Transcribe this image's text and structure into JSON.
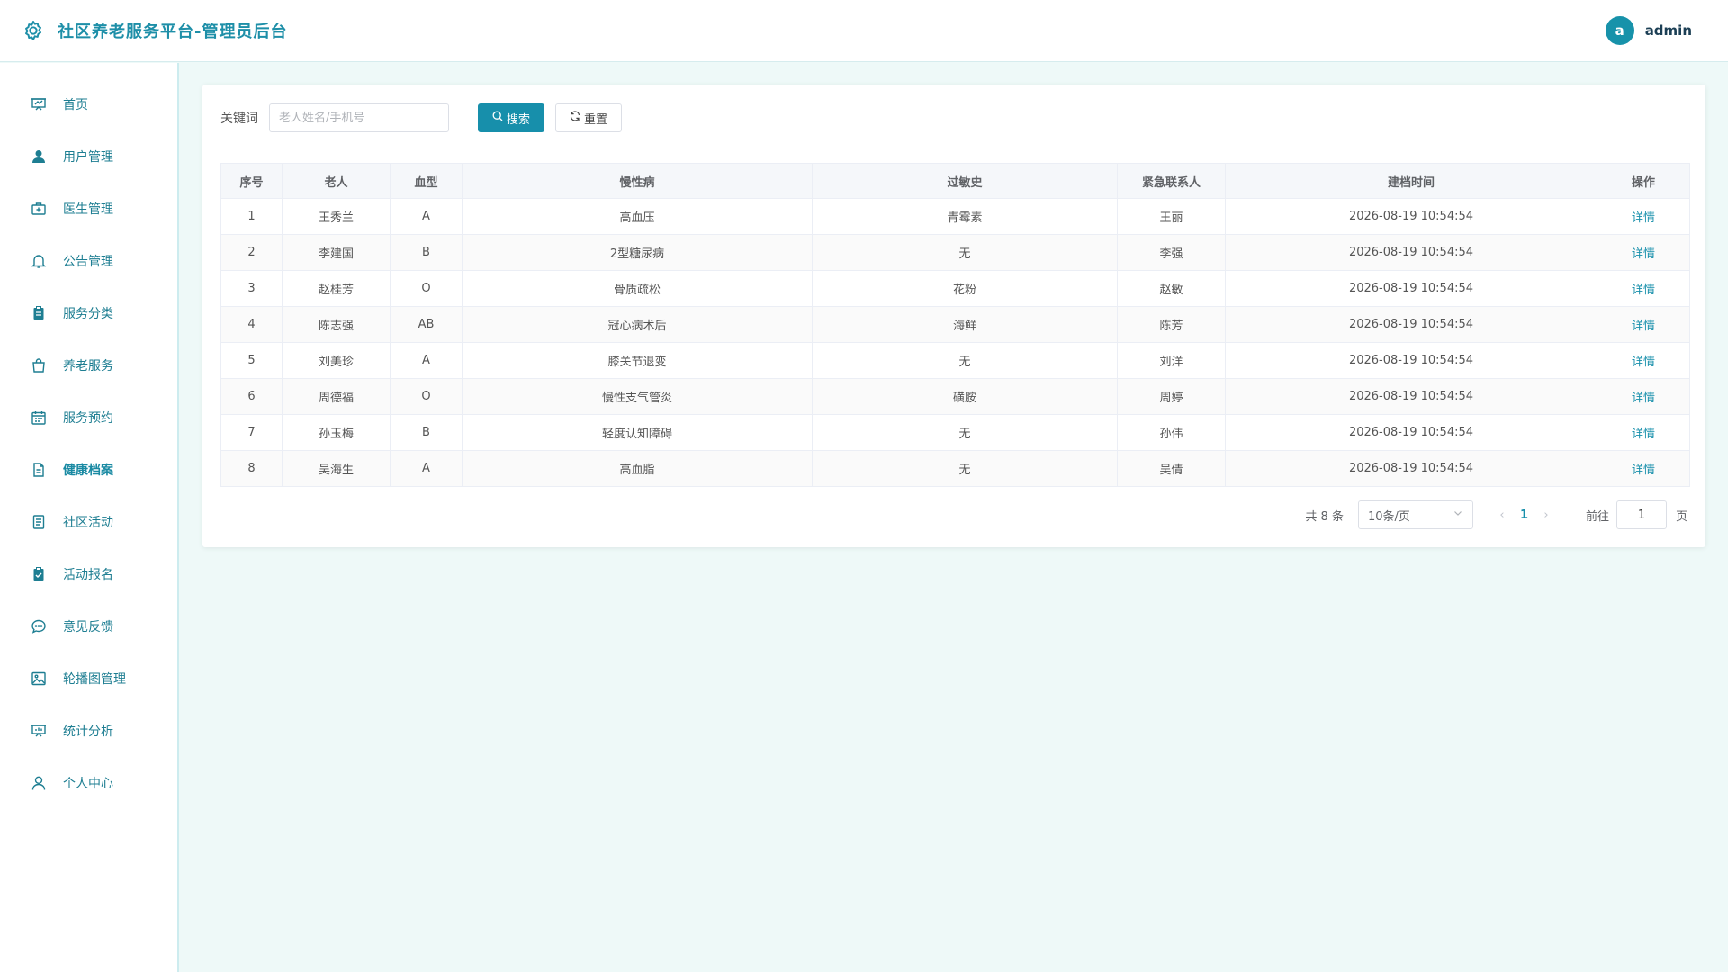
{
  "header": {
    "title": "社区养老服务平台-管理员后台",
    "avatar_letter": "a",
    "username": "admin"
  },
  "sidebar": {
    "items": [
      {
        "label": "首页",
        "icon": "presentation-board-icon"
      },
      {
        "label": "用户管理",
        "icon": "user-filled-icon"
      },
      {
        "label": "医生管理",
        "icon": "first-aid-kit-icon"
      },
      {
        "label": "公告管理",
        "icon": "bell-icon"
      },
      {
        "label": "服务分类",
        "icon": "clipboard-filled-icon"
      },
      {
        "label": "养老服务",
        "icon": "shopping-bag-icon"
      },
      {
        "label": "服务预约",
        "icon": "calendar-icon"
      },
      {
        "label": "健康档案",
        "icon": "document-icon"
      },
      {
        "label": "社区活动",
        "icon": "tickets-icon"
      },
      {
        "label": "活动报名",
        "icon": "checked-clipboard-icon"
      },
      {
        "label": "意见反馈",
        "icon": "chat-bubble-icon"
      },
      {
        "label": "轮播图管理",
        "icon": "picture-icon"
      },
      {
        "label": "统计分析",
        "icon": "data-board-icon"
      },
      {
        "label": "个人中心",
        "icon": "user-outline-icon"
      }
    ],
    "active": "健康档案"
  },
  "search": {
    "label": "关键词",
    "placeholder": "老人姓名/手机号",
    "value": "",
    "search_button": "搜索",
    "reset_button": "重置"
  },
  "table": {
    "columns": [
      "序号",
      "老人",
      "血型",
      "慢性病",
      "过敏史",
      "紧急联系人",
      "建档时间",
      "操作"
    ],
    "rows": [
      {
        "no": "1",
        "name": "王秀兰",
        "blood": "A",
        "chronic": "高血压",
        "allergy": "青霉素",
        "contact": "王丽",
        "created": "2026-08-19 10:54:54",
        "action": "详情"
      },
      {
        "no": "2",
        "name": "李建国",
        "blood": "B",
        "chronic": "2型糖尿病",
        "allergy": "无",
        "contact": "李强",
        "created": "2026-08-19 10:54:54",
        "action": "详情"
      },
      {
        "no": "3",
        "name": "赵桂芳",
        "blood": "O",
        "chronic": "骨质疏松",
        "allergy": "花粉",
        "contact": "赵敏",
        "created": "2026-08-19 10:54:54",
        "action": "详情"
      },
      {
        "no": "4",
        "name": "陈志强",
        "blood": "AB",
        "chronic": "冠心病术后",
        "allergy": "海鲜",
        "contact": "陈芳",
        "created": "2026-08-19 10:54:54",
        "action": "详情"
      },
      {
        "no": "5",
        "name": "刘美珍",
        "blood": "A",
        "chronic": "膝关节退变",
        "allergy": "无",
        "contact": "刘洋",
        "created": "2026-08-19 10:54:54",
        "action": "详情"
      },
      {
        "no": "6",
        "name": "周德福",
        "blood": "O",
        "chronic": "慢性支气管炎",
        "allergy": "磺胺",
        "contact": "周婷",
        "created": "2026-08-19 10:54:54",
        "action": "详情"
      },
      {
        "no": "7",
        "name": "孙玉梅",
        "blood": "B",
        "chronic": "轻度认知障碍",
        "allergy": "无",
        "contact": "孙伟",
        "created": "2026-08-19 10:54:54",
        "action": "详情"
      },
      {
        "no": "8",
        "name": "吴海生",
        "blood": "A",
        "chronic": "高血脂",
        "allergy": "无",
        "contact": "吴倩",
        "created": "2026-08-19 10:54:54",
        "action": "详情"
      }
    ]
  },
  "pagination": {
    "total_text": "共 8 条",
    "page_size": "10条/页",
    "prev": "‹",
    "current": "1",
    "next": "›",
    "goto_label": "前往",
    "goto_value": "1",
    "page_suffix": "页"
  },
  "colors": {
    "accent": "#178fab",
    "background": "#eef9f8"
  }
}
